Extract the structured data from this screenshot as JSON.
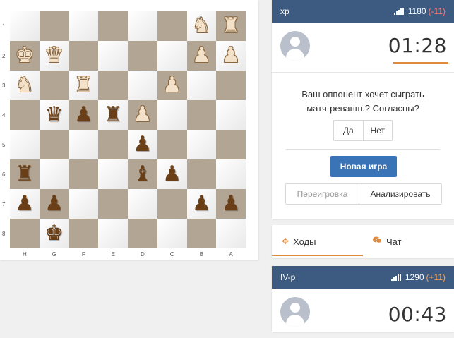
{
  "board": {
    "rank_labels": [
      "1",
      "2",
      "3",
      "4",
      "5",
      "6",
      "7",
      "8"
    ],
    "file_labels": [
      "H",
      "G",
      "F",
      "E",
      "D",
      "C",
      "B",
      "A"
    ],
    "light_color": "#ebebeb",
    "dark_color": "#b3a593",
    "rows": [
      [
        null,
        null,
        null,
        null,
        null,
        null,
        {
          "c": "w",
          "p": "knight"
        },
        {
          "c": "w",
          "p": "rook"
        }
      ],
      [
        {
          "c": "w",
          "p": "king"
        },
        {
          "c": "w",
          "p": "queen"
        },
        null,
        null,
        null,
        null,
        {
          "c": "w",
          "p": "pawn"
        },
        {
          "c": "w",
          "p": "pawn"
        }
      ],
      [
        {
          "c": "w",
          "p": "knight"
        },
        null,
        {
          "c": "w",
          "p": "rook"
        },
        null,
        null,
        {
          "c": "w",
          "p": "pawn"
        },
        null,
        null
      ],
      [
        null,
        {
          "c": "b",
          "p": "queen"
        },
        {
          "c": "b",
          "p": "pawn"
        },
        {
          "c": "b",
          "p": "rook"
        },
        {
          "c": "w",
          "p": "pawn"
        },
        null,
        null,
        null
      ],
      [
        null,
        null,
        null,
        null,
        {
          "c": "b",
          "p": "pawn"
        },
        null,
        null,
        null
      ],
      [
        {
          "c": "b",
          "p": "rook"
        },
        null,
        null,
        null,
        {
          "c": "b",
          "p": "bishop"
        },
        {
          "c": "b",
          "p": "pawn"
        },
        null,
        null
      ],
      [
        {
          "c": "b",
          "p": "pawn"
        },
        {
          "c": "b",
          "p": "pawn"
        },
        null,
        null,
        null,
        null,
        {
          "c": "b",
          "p": "pawn"
        },
        {
          "c": "b",
          "p": "pawn"
        }
      ],
      [
        null,
        {
          "c": "b",
          "p": "king"
        },
        null,
        null,
        null,
        null,
        null,
        null
      ]
    ]
  },
  "top_player": {
    "name": "xp",
    "rating": "1180",
    "rating_delta": "(-11)",
    "clock": "01:28"
  },
  "rematch": {
    "line1": "Ваш оппонент хочет сыграть",
    "line2": "матч-реванш.? Согласны?",
    "yes": "Да",
    "no": "Нет"
  },
  "actions": {
    "new_game": "Новая игра",
    "replay": "Переигровка",
    "analyze": "Анализировать"
  },
  "tabs": [
    {
      "label": "Ходы",
      "icon": "arrows-icon",
      "active": true
    },
    {
      "label": "Чат",
      "icon": "chat-icon",
      "active": false
    }
  ],
  "bottom_player": {
    "name": "IV-p",
    "rating": "1290",
    "rating_delta": "(+11)",
    "clock": "00:43"
  },
  "colors": {
    "header_bg": "#3d5a80",
    "accent_orange": "#e08a3c",
    "button_blue": "#3a73b6"
  }
}
